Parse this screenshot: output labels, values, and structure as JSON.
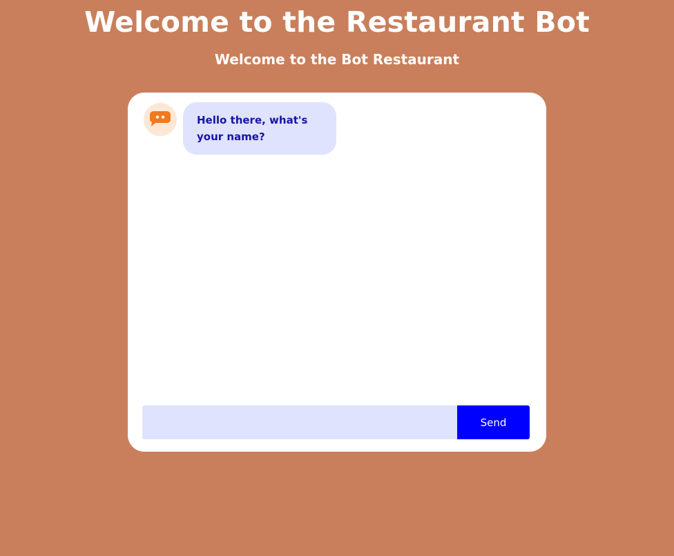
{
  "header": {
    "title": "Welcome to the Restaurant Bot",
    "subtitle": "Welcome to the Bot Restaurant"
  },
  "chat": {
    "avatar_icon": "chat-bubble-icon",
    "messages": [
      {
        "sender": "bot",
        "text": "Hello there, what's your name?"
      }
    ],
    "input": {
      "value": "",
      "placeholder": ""
    },
    "send_label": "Send"
  },
  "colors": {
    "background": "#c97f5c",
    "card": "#ffffff",
    "bubble": "#e0e3fd",
    "bubble_text": "#1714a8",
    "send_button": "#0000ff",
    "avatar_bg": "#fde8d6",
    "avatar_icon": "#f07a1c"
  }
}
